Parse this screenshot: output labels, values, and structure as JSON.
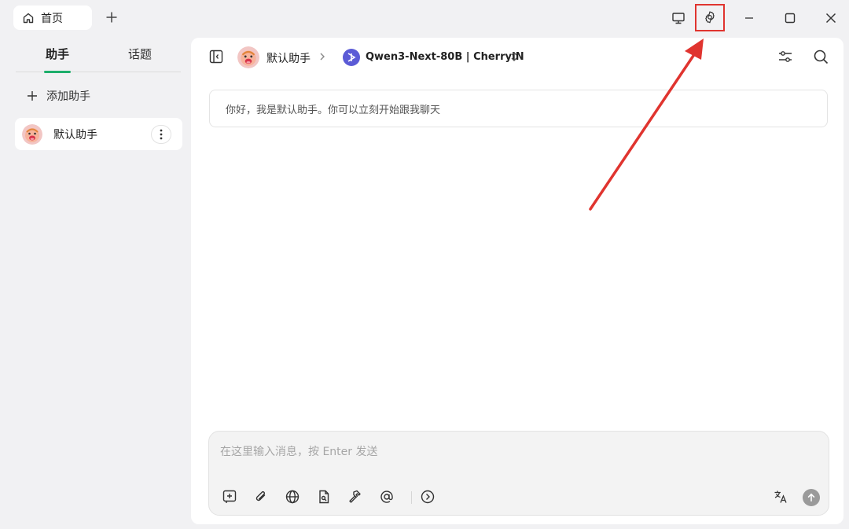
{
  "titlebar": {
    "home_tab": "首页",
    "icons": [
      "home-icon",
      "plus-icon",
      "monitor-icon",
      "gear-icon",
      "minimize-icon",
      "maximize-icon",
      "close-icon"
    ]
  },
  "sidebar": {
    "tabs": [
      {
        "label": "助手"
      },
      {
        "label": "话题"
      }
    ],
    "add_assistant": "添加助手",
    "assistants": [
      {
        "name": "默认助手"
      }
    ]
  },
  "header": {
    "assistant": "默认助手",
    "model": "Qwen3-Next-80B | CherryIN"
  },
  "chat": {
    "greeting": "你好，我是默认助手。你可以立刻开始跟我聊天"
  },
  "input": {
    "placeholder": "在这里输入消息，按 Enter 发送",
    "value": ""
  },
  "colors": {
    "accent": "#1dae6b",
    "annotation": "#e0342f",
    "model_icon": "#5b5bd6"
  }
}
